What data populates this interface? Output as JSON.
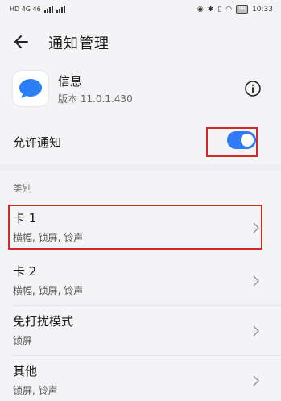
{
  "status_bar": {
    "carrier_left": "HD 4G 46",
    "battery": "98",
    "time": "10:33"
  },
  "header": {
    "title": "通知管理",
    "back_icon": "back-arrow-icon"
  },
  "app": {
    "name": "信息",
    "version": "版本 11.0.1.430",
    "icon": "message-bubble-icon",
    "accent": "#2b7ff5"
  },
  "allow_notifications": {
    "label": "允许通知",
    "enabled": true,
    "toggle_color": "#2f7cf6"
  },
  "categories": {
    "label": "类别",
    "items": [
      {
        "title": "卡 1",
        "subtitle": "横幅, 锁屏, 铃声"
      },
      {
        "title": "卡 2",
        "subtitle": "横幅, 锁屏, 铃声"
      },
      {
        "title": "免打扰模式",
        "subtitle": "锁屏"
      },
      {
        "title": "其他",
        "subtitle": "锁屏, 铃声"
      }
    ]
  },
  "highlight_color": "#d02a2a"
}
